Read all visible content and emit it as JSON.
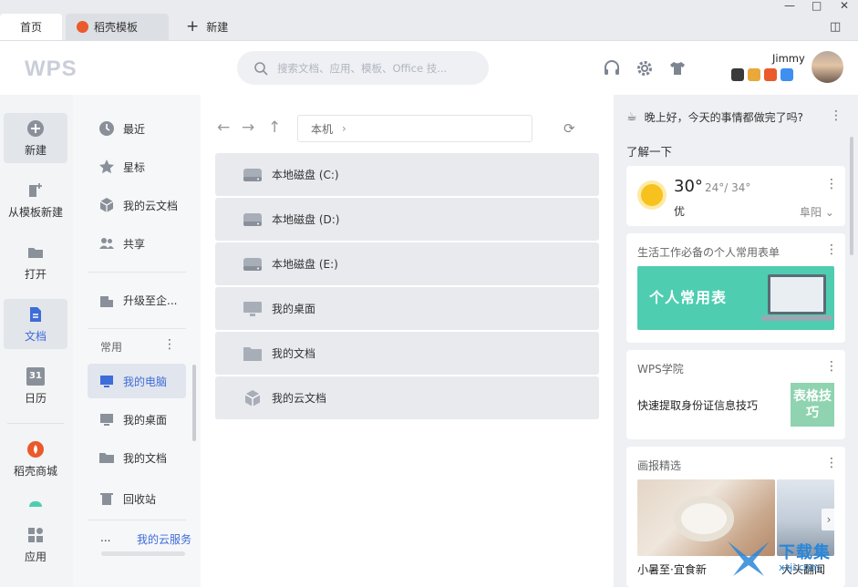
{
  "tabs": [
    {
      "label": "首页",
      "active": true
    },
    {
      "label": "稻壳模板",
      "icon": "daoke-icon"
    },
    {
      "label": "新建",
      "icon": "plus-icon"
    }
  ],
  "window_controls": [
    "—",
    "□",
    "✕",
    "◫"
  ],
  "header": {
    "logo": "WPS",
    "search_placeholder": "搜索文档、应用、模板、Office 技...",
    "user_name": "Jimmy"
  },
  "colors": {
    "accent": "#3e6cd8",
    "daoke": "#ea5a2b",
    "banner": "#4ecdb1"
  },
  "left_nav": [
    {
      "label": "新建",
      "icon": "plus-circle-icon"
    },
    {
      "label": "从模板新建",
      "icon": "template-icon"
    },
    {
      "label": "打开",
      "icon": "folder-icon"
    },
    {
      "label": "文档",
      "icon": "document-icon",
      "active": true
    },
    {
      "label": "日历",
      "icon": "calendar-icon"
    },
    {
      "label": "稻壳商城",
      "icon": "daoke-icon"
    },
    {
      "label": "应用",
      "icon": "apps-icon"
    }
  ],
  "calendar_day": "31",
  "mid_nav": {
    "top": [
      {
        "label": "最近",
        "icon": "clock-icon"
      },
      {
        "label": "星标",
        "icon": "star-icon"
      },
      {
        "label": "我的云文档",
        "icon": "cloud-cube-icon"
      },
      {
        "label": "共享",
        "icon": "users-icon"
      }
    ],
    "upgrade": "升级至企...",
    "section_title": "常用",
    "section_more": "⋮",
    "common": [
      {
        "label": "我的电脑",
        "icon": "computer-icon",
        "active": true
      },
      {
        "label": "我的桌面",
        "icon": "desktop-icon"
      },
      {
        "label": "我的文档",
        "icon": "folder-icon"
      },
      {
        "label": "回收站",
        "icon": "trash-icon"
      }
    ],
    "cloud_service_prefix": "...",
    "cloud_service": "我的云服务"
  },
  "main": {
    "path": "本机",
    "path_sep": "›",
    "items": [
      {
        "label": "本地磁盘 (C:)",
        "icon": "drive-icon"
      },
      {
        "label": "本地磁盘 (D:)",
        "icon": "drive-icon"
      },
      {
        "label": "本地磁盘 (E:)",
        "icon": "drive-icon"
      },
      {
        "label": "我的桌面",
        "icon": "monitor-icon"
      },
      {
        "label": "我的文档",
        "icon": "folder-icon"
      },
      {
        "label": "我的云文档",
        "icon": "cloud-cube-icon"
      }
    ]
  },
  "right": {
    "greeting": "晚上好，今天的事情都做完了吗?",
    "learn_title": "了解一下",
    "weather": {
      "temp": "30°",
      "range": "24°/ 34°",
      "quality": "优",
      "city": "阜阳"
    },
    "form_card": {
      "title": "生活工作必备の个人常用表单",
      "banner_text": "个人常用表"
    },
    "academy": {
      "title": "WPS学院",
      "text": "快速提取身份证信息技巧",
      "img_text": "表格技巧"
    },
    "pictorial": {
      "title": "画报精选",
      "caption1": "小暑至·宜食新",
      "caption2": "大头翻闻"
    },
    "watermark": {
      "main": "下载集",
      "sub": "xzji.com"
    }
  }
}
